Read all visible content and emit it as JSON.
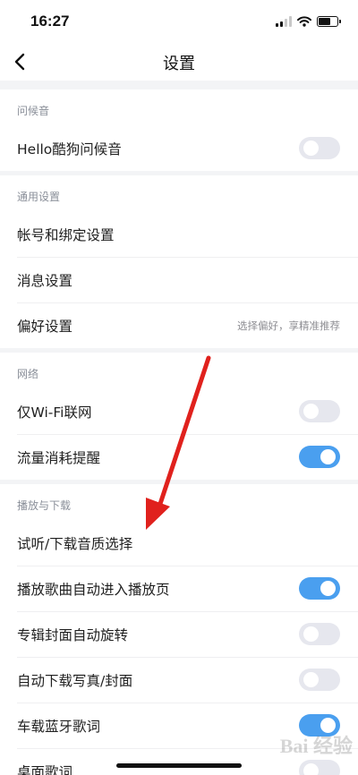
{
  "status_bar": {
    "time": "16:27"
  },
  "nav": {
    "title": "设置"
  },
  "sections": {
    "greeting": {
      "header": "问候音",
      "items": [
        {
          "label": "Hello酷狗问候音",
          "toggle": false
        }
      ]
    },
    "general": {
      "header": "通用设置",
      "items": [
        {
          "label": "帐号和绑定设置"
        },
        {
          "label": "消息设置"
        },
        {
          "label": "偏好设置",
          "hint": "选择偏好，享精准推荐"
        }
      ]
    },
    "network": {
      "header": "网络",
      "items": [
        {
          "label": "仅Wi-Fi联网",
          "toggle": false
        },
        {
          "label": "流量消耗提醒",
          "toggle": true
        }
      ]
    },
    "playback": {
      "header": "播放与下载",
      "items": [
        {
          "label": "试听/下载音质选择"
        },
        {
          "label": "播放歌曲自动进入播放页",
          "toggle": true
        },
        {
          "label": "专辑封面自动旋转",
          "toggle": false
        },
        {
          "label": "自动下载写真/封面",
          "toggle": false
        },
        {
          "label": "车载蓝牙歌词",
          "toggle": true
        },
        {
          "label": "桌面歌词",
          "toggle": false
        }
      ]
    }
  },
  "watermark": {
    "text": "Bai 经验"
  },
  "colors": {
    "accent": "#4a9fef",
    "toggle_off": "#e6e7ee",
    "annotation_arrow": "#e0211d"
  }
}
